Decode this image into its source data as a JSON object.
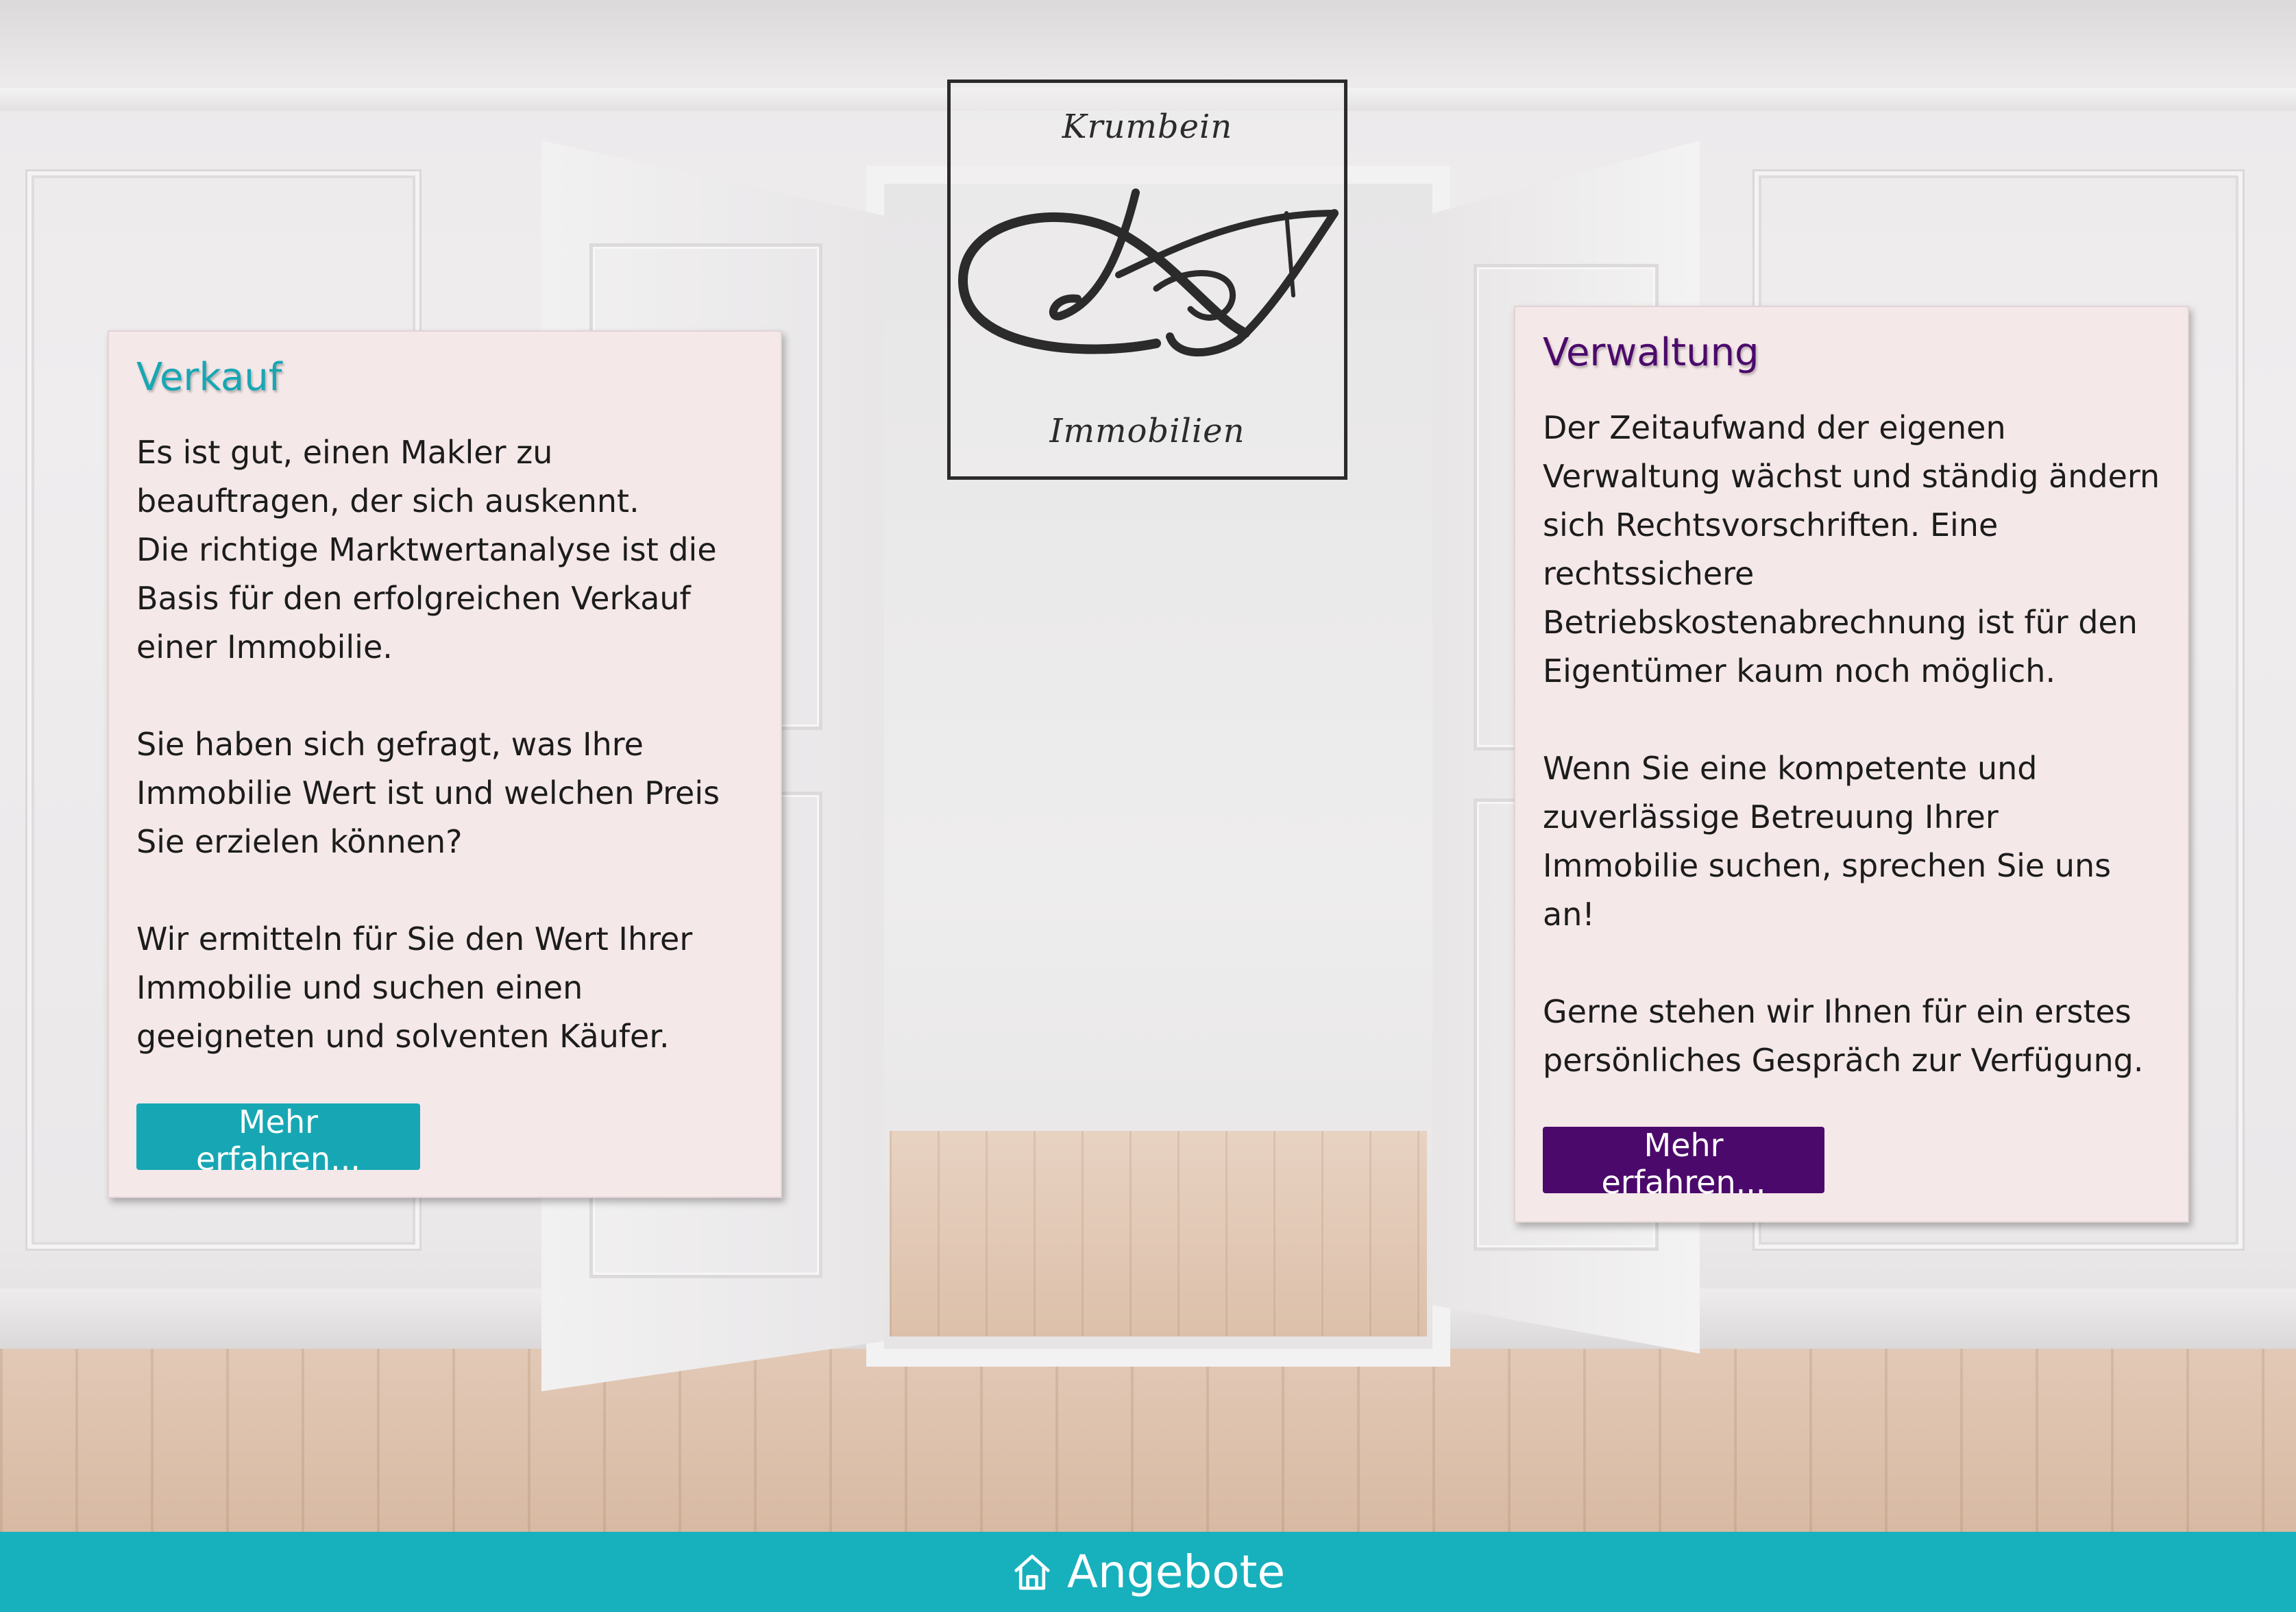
{
  "logo": {
    "top_text": "Krumbein",
    "bottom_text": "Immobilien",
    "monogram": "KI"
  },
  "cards": {
    "verkauf": {
      "title": "Verkauf",
      "paragraphs": [
        "Es ist gut, einen Makler zu beauftragen, der sich auskennt.\nDie richtige Marktwertanalyse ist die Basis für den erfolgreichen Verkauf einer Immobilie.",
        "Sie haben sich gefragt, was Ihre Immobilie Wert ist und welchen Preis Sie erzielen können?",
        "Wir ermitteln für Sie den Wert Ihrer Immobilie und suchen einen geeigneten und solventen Käufer."
      ],
      "button_label": "Mehr erfahren...",
      "accent_color": "#17a7b4"
    },
    "verwaltung": {
      "title": "Verwaltung",
      "paragraphs": [
        "Der Zeitaufwand der eigenen Verwaltung wächst und ständig ändern sich Rechtsvorschriften. Eine rechtssichere Betriebskostenabrechnung ist für den Eigentümer kaum noch möglich.",
        "Wenn Sie eine kompetente und zuverlässige Betreuung Ihrer Immobilie suchen, sprechen Sie uns an!",
        "Gerne stehen wir Ihnen für ein erstes persönliches Gespräch zur Verfügung."
      ],
      "button_label": "Mehr erfahren...",
      "accent_color": "#4b0a6b"
    }
  },
  "bottom_bar": {
    "icon": "home-icon",
    "label": "Angebote",
    "color": "#17b0bd"
  }
}
